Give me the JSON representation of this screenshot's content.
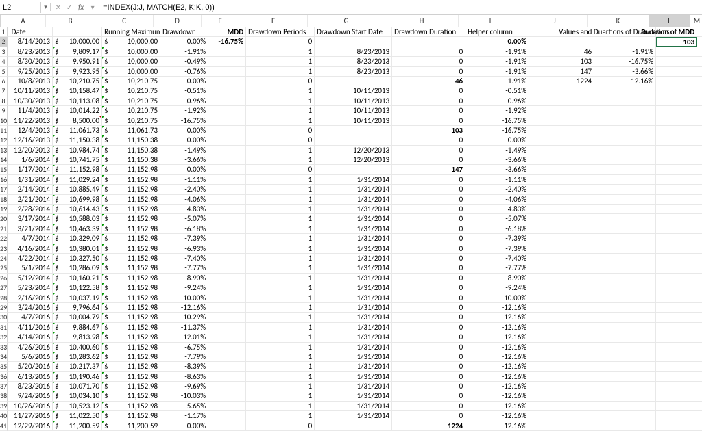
{
  "nameBox": "L2",
  "formula": "=INDEX(J:J, MATCH(E2, K:K, 0))",
  "columns": [
    "A",
    "B",
    "C",
    "D",
    "E",
    "F",
    "G",
    "H",
    "I",
    "J",
    "K",
    "L",
    "M"
  ],
  "colWidths": [
    "cA",
    "cB",
    "cC",
    "cD",
    "cE",
    "cF",
    "cG",
    "cH",
    "cI",
    "cJ",
    "cK",
    "cL",
    "cM"
  ],
  "selectedCol": "L",
  "selectedRow": 2,
  "headers": {
    "A": "Date",
    "C": "Running Maximum",
    "D": "Drawdown",
    "E": "MDD",
    "F": "Drawdown Periods",
    "G": "Drawdown Start Date",
    "H": "Drawdown Duration",
    "I": "Helper column",
    "JK": "Values and Duartions of Drawdowns",
    "L": "Duration of MDD"
  },
  "l2": "103",
  "jkData": [
    {
      "j": "46",
      "k": "-1.91%"
    },
    {
      "j": "103",
      "k": "-16.75%"
    },
    {
      "j": "147",
      "k": "-3.66%"
    },
    {
      "j": "1224",
      "k": "-12.16%"
    }
  ],
  "rows": [
    {
      "n": 2,
      "date": "8/14/2013",
      "b": "10,000.00",
      "c": "10,000.00",
      "d": "0.00%",
      "e": "-16.75%",
      "f": "0",
      "g": "",
      "h": "",
      "i": "0.00%",
      "iBold": true
    },
    {
      "n": 3,
      "date": "8/23/2013",
      "b": "9,809.17",
      "c": "10,000.00",
      "d": "-1.91%",
      "e": "",
      "f": "1",
      "g": "8/23/2013",
      "h": "0",
      "i": "-1.91%",
      "tg": true
    },
    {
      "n": 4,
      "date": "8/30/2013",
      "b": "9,950.91",
      "c": "10,000.00",
      "d": "-0.49%",
      "e": "",
      "f": "1",
      "g": "8/23/2013",
      "h": "0",
      "i": "-1.91%",
      "tg": true
    },
    {
      "n": 5,
      "date": "9/25/2013",
      "b": "9,923.95",
      "c": "10,000.00",
      "d": "-0.76%",
      "e": "",
      "f": "1",
      "g": "8/23/2013",
      "h": "0",
      "i": "-1.91%",
      "tg": true
    },
    {
      "n": 6,
      "date": "10/8/2013",
      "b": "10,210.75",
      "c": "10,210.75",
      "d": "0.00%",
      "e": "",
      "f": "0",
      "g": "",
      "h": "46",
      "i": "-1.91%",
      "hBold": true,
      "tg": true
    },
    {
      "n": 7,
      "date": "10/11/2013",
      "b": "10,158.47",
      "c": "10,210.75",
      "d": "-0.51%",
      "e": "",
      "f": "1",
      "g": "10/11/2013",
      "h": "0",
      "i": "-0.51%",
      "tg": true
    },
    {
      "n": 8,
      "date": "10/30/2013",
      "b": "10,113.08",
      "c": "10,210.75",
      "d": "-0.96%",
      "e": "",
      "f": "1",
      "g": "10/11/2013",
      "h": "0",
      "i": "-0.96%",
      "tg": true
    },
    {
      "n": 9,
      "date": "11/4/2013",
      "b": "10,014.22",
      "c": "10,210.75",
      "d": "-1.92%",
      "e": "",
      "f": "1",
      "g": "10/11/2013",
      "h": "0",
      "i": "-1.92%",
      "tg": true
    },
    {
      "n": 10,
      "date": "11/22/2013",
      "b": "8,500.00",
      "bBold": true,
      "c": "10,210.75",
      "d": "-16.75%",
      "e": "",
      "f": "1",
      "g": "10/11/2013",
      "h": "0",
      "i": "-16.75%",
      "tr": true
    },
    {
      "n": 11,
      "date": "12/4/2013",
      "b": "11,061.73",
      "c": "11,061.73",
      "d": "0.00%",
      "e": "",
      "f": "0",
      "g": "",
      "h": "103",
      "i": "-16.75%",
      "hBold": true,
      "tg": true
    },
    {
      "n": 12,
      "date": "12/16/2013",
      "b": "11,150.38",
      "c": "11,150.38",
      "d": "0.00%",
      "e": "",
      "f": "0",
      "g": "",
      "h": "0",
      "i": "0.00%",
      "tg": true
    },
    {
      "n": 13,
      "date": "12/20/2013",
      "b": "10,984.74",
      "c": "11,150.38",
      "d": "-1.49%",
      "e": "",
      "f": "1",
      "g": "12/20/2013",
      "h": "0",
      "i": "-1.49%",
      "tg": true
    },
    {
      "n": 14,
      "date": "1/6/2014",
      "b": "10,741.75",
      "c": "11,150.38",
      "d": "-3.66%",
      "e": "",
      "f": "1",
      "g": "12/20/2013",
      "h": "0",
      "i": "-3.66%",
      "tg": true
    },
    {
      "n": 15,
      "date": "1/17/2014",
      "b": "11,152.98",
      "c": "11,152.98",
      "d": "0.00%",
      "e": "",
      "f": "0",
      "g": "",
      "h": "147",
      "i": "-3.66%",
      "hBold": true,
      "tg": true
    },
    {
      "n": 16,
      "date": "1/31/2014",
      "b": "11,029.24",
      "c": "11,152.98",
      "d": "-1.11%",
      "e": "",
      "f": "1",
      "g": "1/31/2014",
      "h": "0",
      "i": "-1.11%",
      "tg": true
    },
    {
      "n": 17,
      "date": "2/14/2014",
      "b": "10,885.49",
      "c": "11,152.98",
      "d": "-2.40%",
      "e": "",
      "f": "1",
      "g": "1/31/2014",
      "h": "0",
      "i": "-2.40%",
      "tg": true
    },
    {
      "n": 18,
      "date": "2/21/2014",
      "b": "10,699.98",
      "c": "11,152.98",
      "d": "-4.06%",
      "e": "",
      "f": "1",
      "g": "1/31/2014",
      "h": "0",
      "i": "-4.06%",
      "tg": true
    },
    {
      "n": 19,
      "date": "2/28/2014",
      "b": "10,614.43",
      "c": "11,152.98",
      "d": "-4.83%",
      "e": "",
      "f": "1",
      "g": "1/31/2014",
      "h": "0",
      "i": "-4.83%",
      "tg": true
    },
    {
      "n": 20,
      "date": "3/17/2014",
      "b": "10,588.03",
      "c": "11,152.98",
      "d": "-5.07%",
      "e": "",
      "f": "1",
      "g": "1/31/2014",
      "h": "0",
      "i": "-5.07%",
      "tg": true
    },
    {
      "n": 21,
      "date": "3/21/2014",
      "b": "10,463.39",
      "c": "11,152.98",
      "d": "-6.18%",
      "e": "",
      "f": "1",
      "g": "1/31/2014",
      "h": "0",
      "i": "-6.18%",
      "tg": true
    },
    {
      "n": 22,
      "date": "4/7/2014",
      "b": "10,329.09",
      "c": "11,152.98",
      "d": "-7.39%",
      "e": "",
      "f": "1",
      "g": "1/31/2014",
      "h": "0",
      "i": "-7.39%",
      "tg": true
    },
    {
      "n": 23,
      "date": "4/16/2014",
      "b": "10,380.01",
      "c": "11,152.98",
      "d": "-6.93%",
      "e": "",
      "f": "1",
      "g": "1/31/2014",
      "h": "0",
      "i": "-7.39%",
      "tg": true
    },
    {
      "n": 24,
      "date": "4/22/2014",
      "b": "10,327.50",
      "c": "11,152.98",
      "d": "-7.40%",
      "e": "",
      "f": "1",
      "g": "1/31/2014",
      "h": "0",
      "i": "-7.40%",
      "tg": true
    },
    {
      "n": 25,
      "date": "5/1/2014",
      "b": "10,286.09",
      "c": "11,152.98",
      "d": "-7.77%",
      "e": "",
      "f": "1",
      "g": "1/31/2014",
      "h": "0",
      "i": "-7.77%",
      "tg": true
    },
    {
      "n": 26,
      "date": "5/12/2014",
      "b": "10,160.21",
      "c": "11,152.98",
      "d": "-8.90%",
      "e": "",
      "f": "1",
      "g": "1/31/2014",
      "h": "0",
      "i": "-8.90%",
      "tg": true
    },
    {
      "n": 27,
      "date": "5/23/2014",
      "b": "10,122.58",
      "c": "11,152.98",
      "d": "-9.24%",
      "e": "",
      "f": "1",
      "g": "1/31/2014",
      "h": "0",
      "i": "-9.24%",
      "tg": true
    },
    {
      "n": 28,
      "date": "2/16/2016",
      "b": "10,037.19",
      "c": "11,152.98",
      "d": "-10.00%",
      "e": "",
      "f": "1",
      "g": "1/31/2014",
      "h": "0",
      "i": "-10.00%",
      "tg": true
    },
    {
      "n": 29,
      "date": "3/24/2016",
      "b": "9,796.64",
      "c": "11,152.98",
      "d": "-12.16%",
      "e": "",
      "f": "1",
      "g": "1/31/2014",
      "h": "0",
      "i": "-12.16%",
      "tg": true
    },
    {
      "n": 30,
      "date": "4/7/2016",
      "b": "10,004.79",
      "c": "11,152.98",
      "d": "-10.29%",
      "e": "",
      "f": "1",
      "g": "1/31/2014",
      "h": "0",
      "i": "-12.16%",
      "tg": true
    },
    {
      "n": 31,
      "date": "4/11/2016",
      "b": "9,884.67",
      "c": "11,152.98",
      "d": "-11.37%",
      "e": "",
      "f": "1",
      "g": "1/31/2014",
      "h": "0",
      "i": "-12.16%",
      "tg": true
    },
    {
      "n": 32,
      "date": "4/14/2016",
      "b": "9,813.98",
      "c": "11,152.98",
      "d": "-12.01%",
      "e": "",
      "f": "1",
      "g": "1/31/2014",
      "h": "0",
      "i": "-12.16%",
      "tg": true
    },
    {
      "n": 33,
      "date": "4/26/2016",
      "b": "10,400.60",
      "c": "11,152.98",
      "d": "-6.75%",
      "e": "",
      "f": "1",
      "g": "1/31/2014",
      "h": "0",
      "i": "-12.16%",
      "tg": true
    },
    {
      "n": 34,
      "date": "5/6/2016",
      "b": "10,283.62",
      "c": "11,152.98",
      "d": "-7.79%",
      "e": "",
      "f": "1",
      "g": "1/31/2014",
      "h": "0",
      "i": "-12.16%",
      "tg": true
    },
    {
      "n": 35,
      "date": "5/20/2016",
      "b": "10,217.37",
      "c": "11,152.98",
      "d": "-8.39%",
      "e": "",
      "f": "1",
      "g": "1/31/2014",
      "h": "0",
      "i": "-12.16%",
      "tg": true
    },
    {
      "n": 36,
      "date": "6/13/2016",
      "b": "10,190.46",
      "c": "11,152.98",
      "d": "-8.63%",
      "e": "",
      "f": "1",
      "g": "1/31/2014",
      "h": "0",
      "i": "-12.16%",
      "tg": true
    },
    {
      "n": 37,
      "date": "8/23/2016",
      "b": "10,071.70",
      "c": "11,152.98",
      "d": "-9.69%",
      "e": "",
      "f": "1",
      "g": "1/31/2014",
      "h": "0",
      "i": "-12.16%",
      "tg": true
    },
    {
      "n": 38,
      "date": "9/24/2016",
      "b": "10,034.10",
      "c": "11,152.98",
      "d": "-10.03%",
      "e": "",
      "f": "1",
      "g": "1/31/2014",
      "h": "0",
      "i": "-12.16%",
      "tg": true
    },
    {
      "n": 39,
      "date": "10/26/2016",
      "b": "10,523.12",
      "c": "11,152.98",
      "d": "-5.65%",
      "e": "",
      "f": "1",
      "g": "1/31/2014",
      "h": "0",
      "i": "-12.16%",
      "tg": true
    },
    {
      "n": 40,
      "date": "11/27/2016",
      "b": "11,022.50",
      "c": "11,152.98",
      "d": "-1.17%",
      "e": "",
      "f": "1",
      "g": "1/31/2014",
      "h": "0",
      "i": "-12.16%",
      "tg": true
    },
    {
      "n": 41,
      "date": "12/29/2016",
      "b": "11,200.59",
      "c": "11,200.59",
      "d": "0.00%",
      "e": "",
      "f": "0",
      "g": "",
      "h": "1224",
      "i": "-12.16%",
      "hBold": true,
      "tg": true
    }
  ]
}
